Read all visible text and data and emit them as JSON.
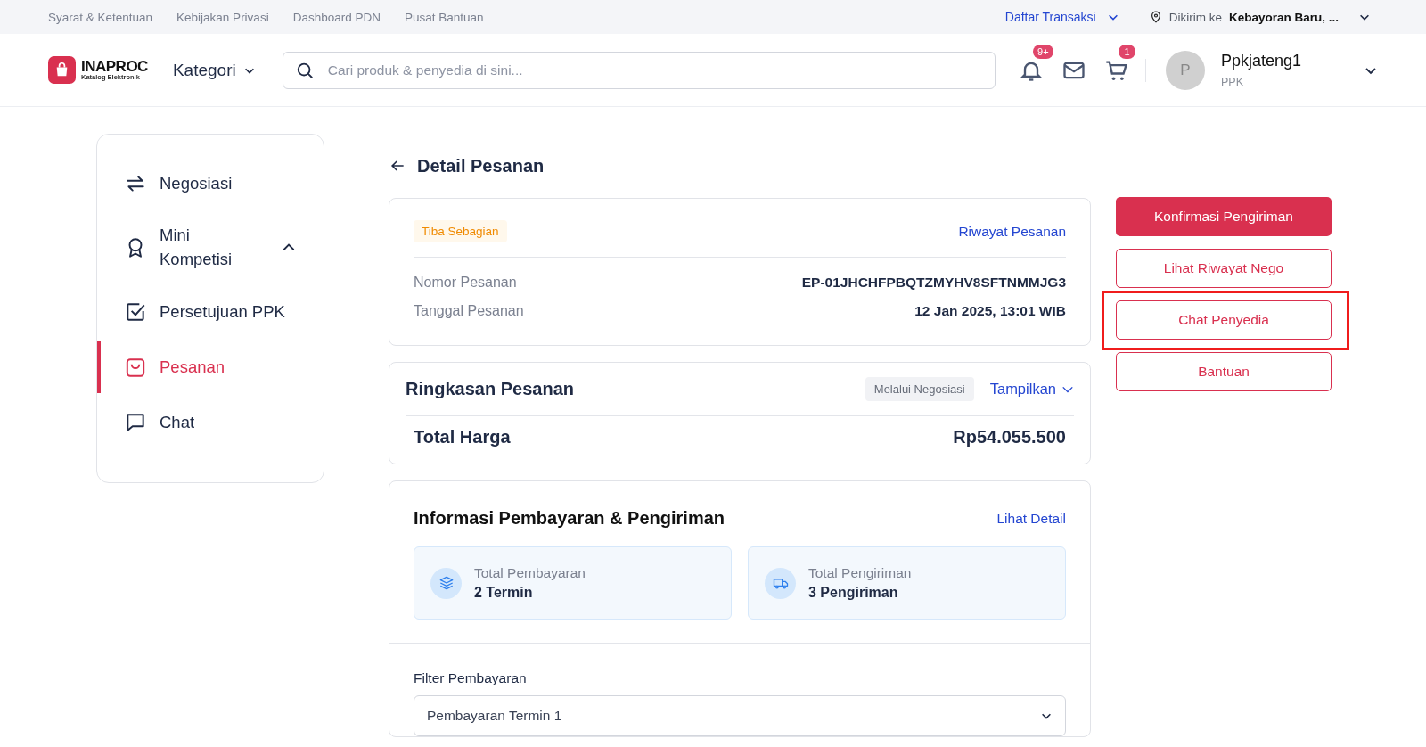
{
  "top_links": [
    "Syarat & Ketentuan",
    "Kebijakan Privasi",
    "Dashboard PDN",
    "Pusat Bantuan"
  ],
  "transactions_menu": {
    "label": "Daftar Transaksi"
  },
  "delivery": {
    "label": "Dikirim ke",
    "location": "Kebayoran Baru, ..."
  },
  "logo": {
    "name": "INAPROC",
    "tagline": "Katalog Elektronik"
  },
  "category_menu": {
    "label": "Kategori"
  },
  "search": {
    "placeholder": "Cari produk & penyedia di sini..."
  },
  "notifications": {
    "badge": "9+"
  },
  "cart": {
    "badge": "1"
  },
  "user": {
    "initial": "P",
    "name": "Ppkjateng1",
    "role": "PPK"
  },
  "sidebar": {
    "items": [
      {
        "kind": "swap",
        "label": "Negosiasi",
        "selected": false
      },
      {
        "kind": "award",
        "label": "Mini Kompetisi",
        "selected": false,
        "expanded": true
      },
      {
        "kind": "check",
        "label": "Persetujuan PPK",
        "selected": false
      },
      {
        "kind": "bag",
        "label": "Pesanan",
        "selected": true
      },
      {
        "kind": "chat",
        "label": "Chat",
        "selected": false
      }
    ]
  },
  "page_title": "Detail Pesanan",
  "order": {
    "status": "Tiba Sebagian",
    "history_link": "Riwayat Pesanan",
    "fields": [
      {
        "label": "Nomor Pesanan",
        "value": "EP-01JHCHFPBQTZMYHV8SFTNMMJG3"
      },
      {
        "label": "Tanggal Pesanan",
        "value": "12 Jan 2025, 13:01 WIB"
      }
    ]
  },
  "summary": {
    "title": "Ringkasan Pesanan",
    "tag": "Melalui Negosiasi",
    "toggle": "Tampilkan",
    "total_label": "Total Harga",
    "total_value": "Rp54.055.500"
  },
  "payment_info": {
    "title": "Informasi Pembayaran & Pengiriman",
    "detail_link": "Lihat Detail",
    "stats": [
      {
        "kind": "layers",
        "label": "Total Pembayaran",
        "value": "2 Termin"
      },
      {
        "kind": "truck",
        "label": "Total Pengiriman",
        "value": "3 Pengiriman"
      }
    ],
    "filter_label": "Filter Pembayaran",
    "filter_value": "Pembayaran Termin 1"
  },
  "actions": [
    {
      "kind": "primary",
      "label": "Konfirmasi Pengiriman",
      "highlighted": false
    },
    {
      "kind": "outline",
      "label": "Lihat Riwayat Nego",
      "highlighted": false
    },
    {
      "kind": "outline",
      "label": "Chat Penyedia",
      "highlighted": true
    },
    {
      "kind": "outline",
      "label": "Bantuan",
      "highlighted": false
    }
  ]
}
